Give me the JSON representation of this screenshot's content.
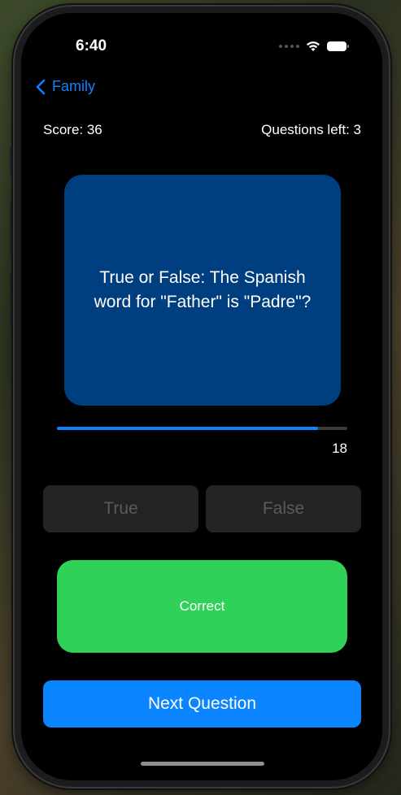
{
  "status_bar": {
    "time": "6:40"
  },
  "nav": {
    "back_label": "Family"
  },
  "stats": {
    "score": "Score: 36",
    "questions_left": "Questions left: 3"
  },
  "question": {
    "text": "True or False: The Spanish word for \"Father\" is \"Padre\"?"
  },
  "timer": {
    "value": "18",
    "progress_fraction": 0.9
  },
  "answers": {
    "true_label": "True",
    "false_label": "False"
  },
  "result": {
    "label": "Correct"
  },
  "next_button": {
    "label": "Next Question"
  },
  "colors": {
    "card": "#003f7f",
    "accent": "#0a84ff",
    "correct": "#30d158",
    "answer_button": "#232325"
  }
}
